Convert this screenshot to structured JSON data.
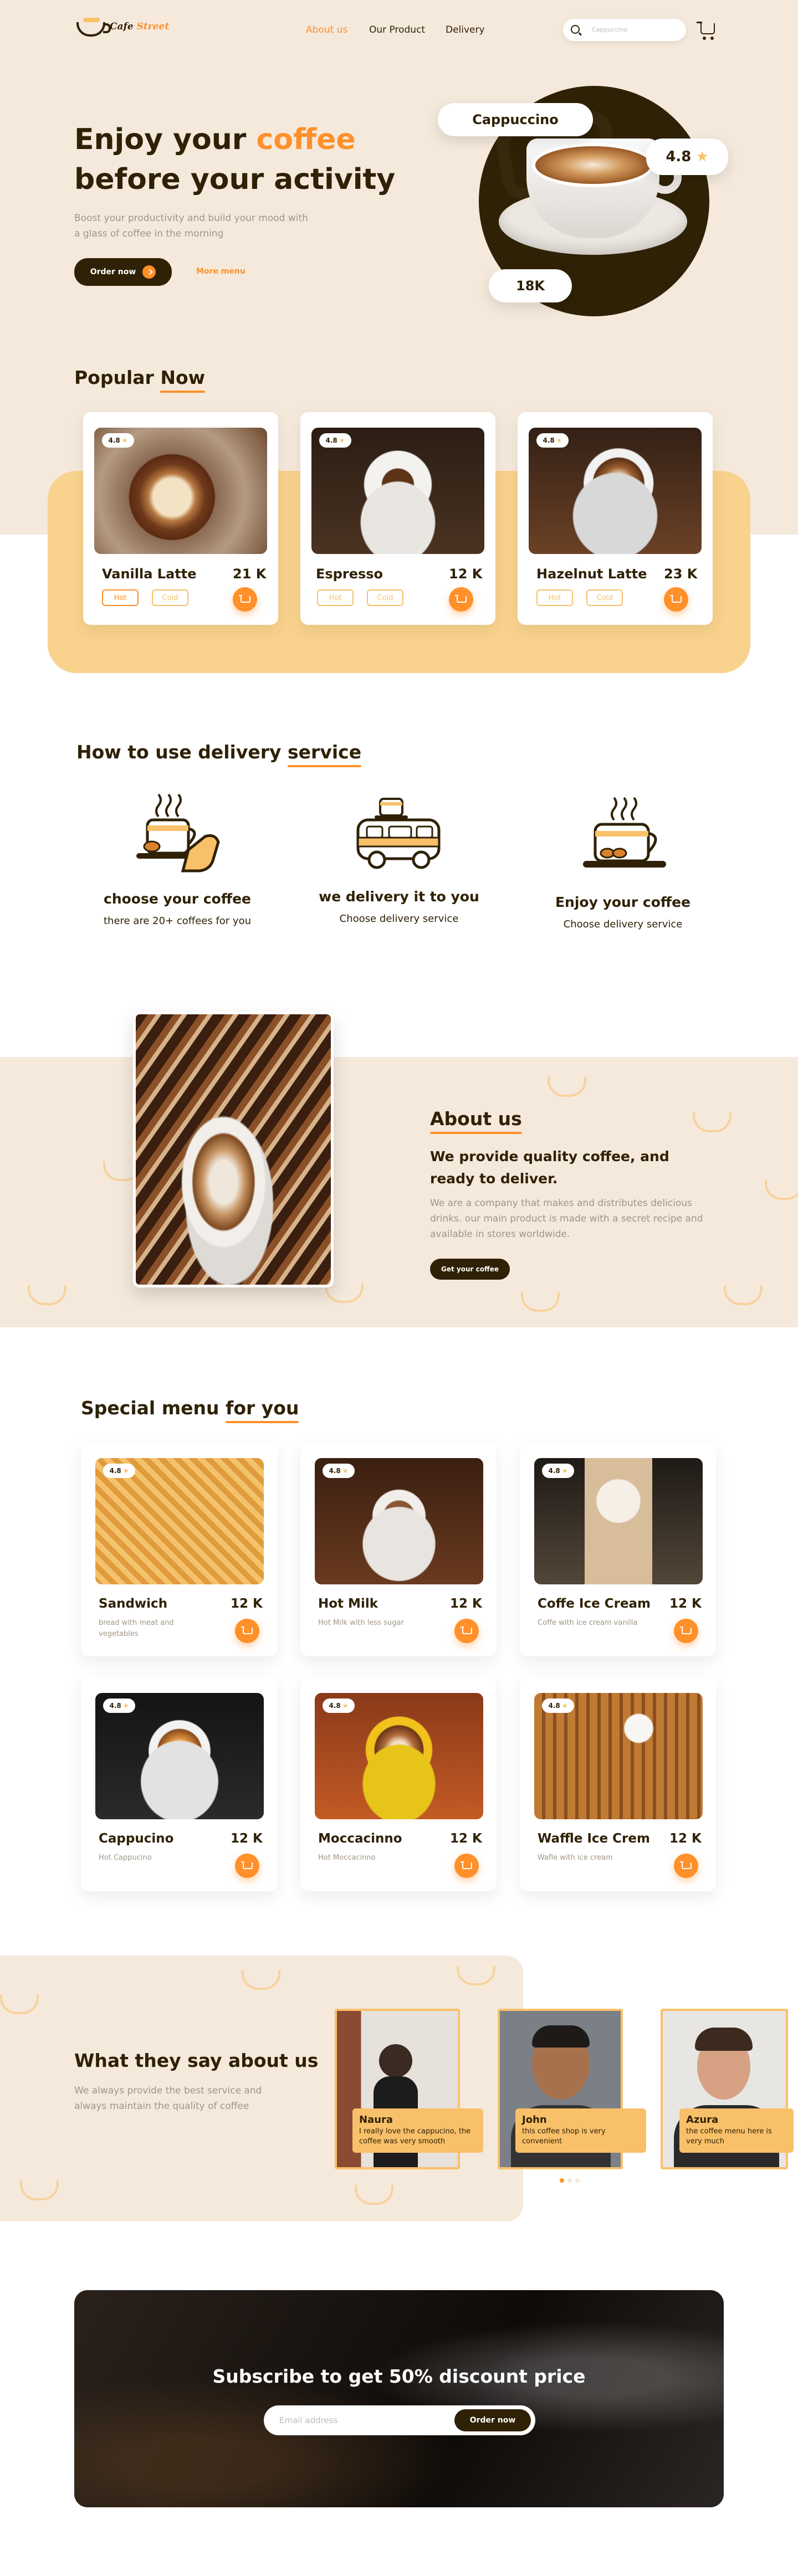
{
  "nav": {
    "logo_main": "Cafe",
    "logo_accent": "Street",
    "links": [
      "About us",
      "Our Product",
      "Delivery"
    ],
    "active_link": "About us",
    "search_placeholder": "Cappuccino",
    "icons": [
      "search-icon",
      "cart-icon"
    ]
  },
  "hero": {
    "title_1": "Enjoy your",
    "title_accent": "coffee",
    "title_2": "before your activity",
    "subtitle": "Boost your productivity and build your mood with a glass of coffee in the morning",
    "order_label": "Order now",
    "more_label": "More menu",
    "product_name": "Cappuccino",
    "rating": "4.8",
    "count": "18K"
  },
  "popular": {
    "title_1": "Popular",
    "title_accent": "Now",
    "items": [
      {
        "name": "Vanilla Latte",
        "price": "21 K",
        "rating": "4.8",
        "hot": "Hot",
        "cold": "Cold"
      },
      {
        "name": "Espresso",
        "price": "12 K",
        "rating": "4.8",
        "hot": "Hot",
        "cold": "Cold"
      },
      {
        "name": "Hazelnut Latte",
        "price": "23 K",
        "rating": "4.8",
        "hot": "Hot",
        "cold": "Cold"
      }
    ]
  },
  "howto": {
    "title_1": "How to use delivery",
    "title_accent": "service",
    "steps": [
      {
        "title": "choose your coffee",
        "desc": "there are 20+ coffees for you"
      },
      {
        "title": "we delivery it to you",
        "desc": "Choose delivery service"
      },
      {
        "title": "Enjoy your coffee",
        "desc": "Choose delivery service"
      }
    ]
  },
  "about": {
    "title": "About us",
    "lead": "We provide quality coffee, and ready to deliver.",
    "body": "We are a company that makes and distributes delicious drinks. our main product is made with a secret recipe and available in stores worldwide.",
    "button": "Get your coffee"
  },
  "special": {
    "title_1": "Special menu",
    "title_accent": "for you",
    "items": [
      {
        "name": "Sandwich",
        "price": "12 K",
        "rating": "4.8",
        "desc": "bread with meat and vegetables"
      },
      {
        "name": "Hot Milk",
        "price": "12 K",
        "rating": "4.8",
        "desc": "Hot Milk with less sugar"
      },
      {
        "name": "Coffe Ice Cream",
        "price": "12 K",
        "rating": "4.8",
        "desc": "Coffe with ice cream vanilla"
      },
      {
        "name": "Cappucino",
        "price": "12 K",
        "rating": "4.8",
        "desc": "Hot Cappucino"
      },
      {
        "name": "Moccacinno",
        "price": "12 K",
        "rating": "4.8",
        "desc": "Hot Moccacinno"
      },
      {
        "name": "Waffle Ice Crem",
        "price": "12 K",
        "rating": "4.8",
        "desc": "Wafle with ice cream"
      }
    ]
  },
  "testimonials": {
    "title": "What they say about us",
    "subtitle": "We always provide the best service and always maintain the quality of coffee",
    "items": [
      {
        "name": "Naura",
        "text": "I really love the cappucino, the coffee was very smooth"
      },
      {
        "name": "John",
        "text": "this coffee shop is very convenient"
      },
      {
        "name": "Azura",
        "text": "the coffee menu here is very much"
      }
    ]
  },
  "subscribe": {
    "title": "Subscribe to get 50% discount price",
    "placeholder": "Email address",
    "button": "Order now"
  },
  "colors": {
    "accent": "#ff902a",
    "dark": "#2f2105",
    "cream": "#f5e9dc",
    "yellow": "#f9c06a"
  }
}
